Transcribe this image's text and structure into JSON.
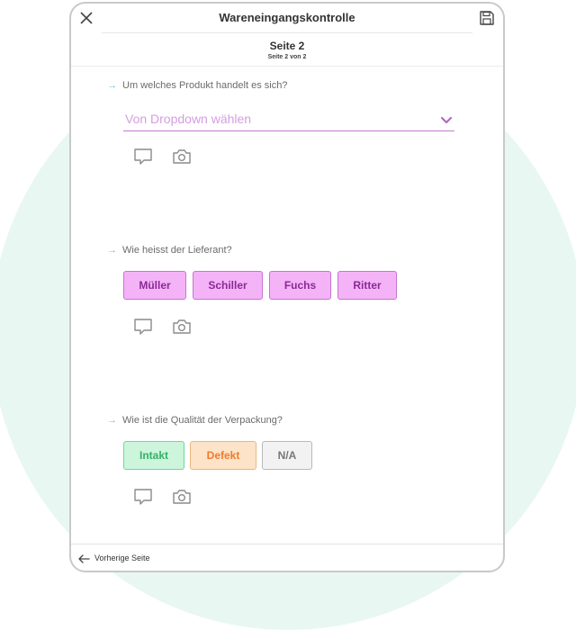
{
  "app": {
    "title": "Wareneingangskontrolle"
  },
  "page": {
    "title": "Seite 2",
    "subtitle": "Seite 2 von 2"
  },
  "questions": [
    {
      "label": "Um welches Produkt handelt es sich?",
      "dropdown_placeholder": "Von Dropdown wählen"
    },
    {
      "label": "Wie heisst der Lieferant?",
      "options": [
        "Müller",
        "Schiller",
        "Fuchs",
        "Ritter"
      ]
    },
    {
      "label": "Wie ist die Qualität der Verpackung?",
      "options": [
        "Intakt",
        "Defekt",
        "N/A"
      ]
    }
  ],
  "footer": {
    "prev_label": "Vorherige Seite"
  },
  "colors": {
    "background_circle": "#e8f7f1",
    "supplier_chip": "#f4b3f7",
    "ok": "#36b067",
    "bad": "#f07a2f",
    "arrow": "#5fc9dc"
  },
  "icons": [
    "close-icon",
    "save-icon",
    "chevron-down-icon",
    "comment-icon",
    "camera-icon",
    "arrow-left-icon"
  ]
}
